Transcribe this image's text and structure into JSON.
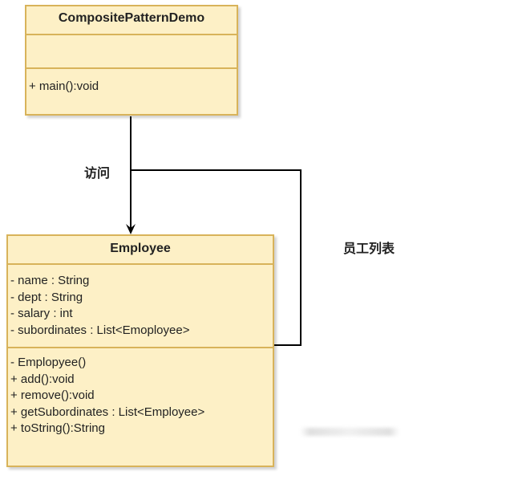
{
  "classes": {
    "demo": {
      "name": "CompositePatternDemo",
      "attributes": [],
      "operations": [
        "+ main():void"
      ]
    },
    "employee": {
      "name": "Employee",
      "attributes": [
        "- name : String",
        "- dept : String",
        "- salary : int",
        "- subordinates : List<Emoployee>"
      ],
      "operations": [
        "- Emplopyee()",
        "+ add():void",
        "+ remove():void",
        "+ getSubordinates : List<Employee>",
        "+ toString():String"
      ]
    }
  },
  "edges": {
    "access_label": "访问",
    "employee_list_label": "员工列表"
  },
  "colors": {
    "class_fill": "#fdf0c6",
    "class_border": "#d8b35a",
    "edge_stroke": "#000000"
  }
}
